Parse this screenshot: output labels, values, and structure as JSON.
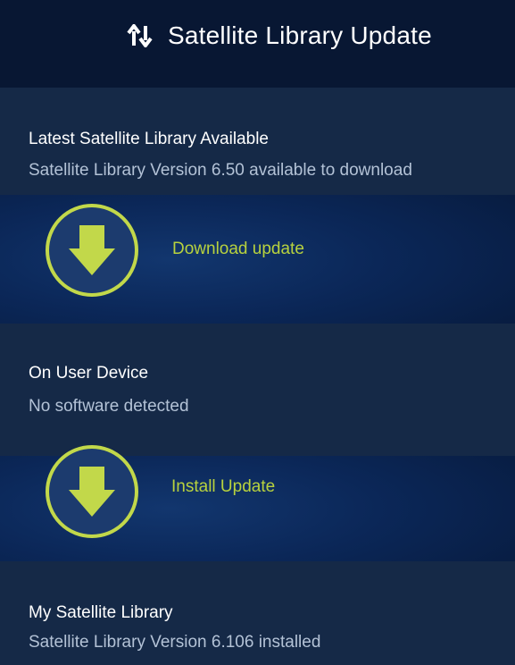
{
  "header": {
    "title": "Satellite Library Update",
    "icon": "up-down-arrows-icon"
  },
  "latest": {
    "heading": "Latest Satellite Library Available",
    "status": "Satellite Library Version 6.50 available to download",
    "action_label": "Download update",
    "action_icon": "download-arrow-icon"
  },
  "device": {
    "heading": "On User Device",
    "status": "No software detected",
    "action_label": "Install Update",
    "action_icon": "download-arrow-icon"
  },
  "library": {
    "heading": "My Satellite Library",
    "status": "Satellite Library Version 6.106 installed"
  },
  "colors": {
    "accent": "#c2d84a",
    "header_bg": "#081733",
    "section_bg": "#152947",
    "band_bg": "#0b2758"
  }
}
